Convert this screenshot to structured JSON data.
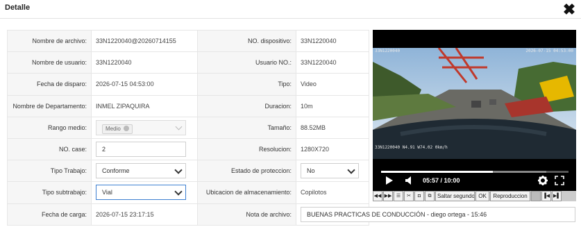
{
  "dialog": {
    "title": "Detalle",
    "close_icon": "close-icon"
  },
  "fields": {
    "nombre_archivo": {
      "label": "Nombre de archivo:",
      "value": "33N1220040@20260714155"
    },
    "no_dispositivo": {
      "label": "NO. dispositivo:",
      "value": "33N1220040"
    },
    "nombre_usuario": {
      "label": "Nombre de usuario:",
      "value": "33N1220040"
    },
    "usuario_no": {
      "label": "Usuario NO.:",
      "value": "33N1220040"
    },
    "fecha_disparo": {
      "label": "Fecha de disparo:",
      "value": "2026-07-15 04:53:00"
    },
    "tipo": {
      "label": "Tipo:",
      "value": "Video"
    },
    "nombre_departamento": {
      "label": "Nombre de Departamento:",
      "value": "INMEL ZIPAQUIRA"
    },
    "duracion": {
      "label": "Duracion:",
      "value": "10m"
    },
    "rango_medio": {
      "label": "Rango medio:",
      "chip": "Medio"
    },
    "tamano": {
      "label": "Tamaño:",
      "value": "88.52MB"
    },
    "no_case": {
      "label": "NO. case:",
      "value": "2"
    },
    "resolucion": {
      "label": "Resolucion:",
      "value": "1280X720"
    },
    "tipo_trabajo": {
      "label": "Tipo Trabajo:",
      "value": "Conforme"
    },
    "estado_proteccion": {
      "label": "Estado de proteccion:",
      "value": "No"
    },
    "tipo_subtrabajo": {
      "label": "Tipo subtrabajo:",
      "value": "Vial"
    },
    "ubicacion": {
      "label": "Ubicacion de almacenamiento:",
      "value": "Copilotos"
    },
    "fecha_carga": {
      "label": "Fecha de carga:",
      "value": "2026-07-15 23:17:15"
    },
    "nota_archivo": {
      "label": "Nota de archivo:",
      "value": "BUENAS PRACTICAS DE CONDUCCIÓN - diego ortega - 15:46"
    }
  },
  "video": {
    "overlay_top_left": "33N1220040",
    "overlay_top_right": "2026-07-15 04:53:00",
    "overlay_bottom": "33N1220040 N4.91 W74.02 0km/h",
    "current_time": "05:57",
    "duration": "10:00",
    "progress": 0.595,
    "buffered": 0.88,
    "play_icon": "play-icon",
    "volume_icon": "volume-icon",
    "settings_icon": "gear-icon",
    "fullscreen_icon": "fullscreen-icon"
  },
  "toolbar": {
    "skip_label": "Saltar segundos",
    "ok_label": "OK",
    "playback_label": "Reproduccion"
  }
}
